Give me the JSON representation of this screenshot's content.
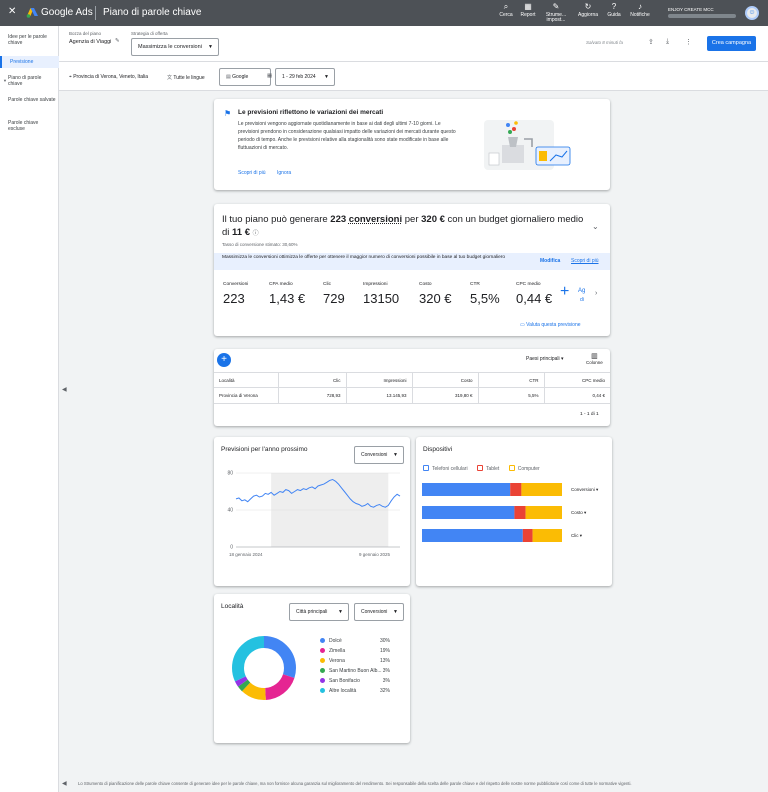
{
  "header": {
    "close_icon": "close-icon",
    "brand": "Google Ads",
    "title": "Piano di parole chiave",
    "toolbar": [
      {
        "label": "Cerca",
        "icon": "search-icon",
        "glyph": "⌕"
      },
      {
        "label": "Report",
        "icon": "report-icon",
        "glyph": "▦"
      },
      {
        "label": "Strume... impost...",
        "icon": "tools-icon",
        "glyph": "✎"
      },
      {
        "label": "Aggiorna",
        "icon": "refresh-icon",
        "glyph": "↻"
      },
      {
        "label": "Guida",
        "icon": "help-icon",
        "glyph": "?"
      },
      {
        "label": "Notifiche",
        "icon": "bell-icon",
        "glyph": "♪"
      }
    ],
    "account": "ENJOY CREATE MCC"
  },
  "sidebar": {
    "items": [
      {
        "label": "Idee per le parole chiave",
        "active": false
      },
      {
        "label": "Previsione",
        "active": true
      },
      {
        "label": "Piano di parole chiave",
        "active": false
      },
      {
        "label": "Parole chiave salvate",
        "active": false
      },
      {
        "label": "Parole chiave escluse",
        "active": false
      }
    ]
  },
  "plan": {
    "draft_label": "Bozza del piano",
    "draft_name": "Agenzia di Viaggi",
    "strategy_label": "Strategia di offerta",
    "strategy_value": "Massimizza le conversioni",
    "saved": "Salvato 8 minuti fa",
    "create_button": "Crea campagna"
  },
  "filters": {
    "location": "Provincia di Verona, Veneto, Italia",
    "languages": "Tutte le lingue",
    "network": "Google",
    "dates": "1 - 29 feb 2024"
  },
  "info": {
    "title": "Le previsioni riflettono le variazioni dei mercati",
    "body": "Le previsioni vengono aggiornate quotidianamente in base ai dati degli ultimi 7-10 giorni. Le previsioni prendono in considerazione qualsiasi impatto delle variazioni dei mercati durante questo periodo di tempo. Anche le previsioni relative alla stagionalità sono state modificate in base alle fluttuazioni di mercato.",
    "learn_more": "Scopri di più",
    "ignore": "Ignora"
  },
  "forecast": {
    "headline_1": "Il tuo piano può generare",
    "conv_count": "223",
    "conv_word": "conversioni",
    "headline_2": "per",
    "cost": "320 €",
    "headline_3": "con un budget giornaliero medio di",
    "budget": "11 €",
    "rate": "Tasso di conversione stimato: 30,60%",
    "banner": "Massimizza le conversioni ottimizza le offerte per ottenere il maggior numero di conversioni possibile in base al tuo budget giornaliero",
    "banner_edit": "Modifica",
    "banner_learn": "Scopri di più",
    "metrics": [
      {
        "label": "Conversioni",
        "value": "223"
      },
      {
        "label": "CPA medio",
        "value": "1,43 €"
      },
      {
        "label": "Clic",
        "value": "729"
      },
      {
        "label": "Impressioni",
        "value": "13150"
      },
      {
        "label": "Costo",
        "value": "320 €"
      },
      {
        "label": "CTR",
        "value": "5,5%"
      },
      {
        "label": "CPC medio",
        "value": "0,44 €"
      }
    ],
    "add_label": "Ag",
    "add_sub": "di",
    "rate_link": "Valuta questa previsione"
  },
  "table": {
    "top_countries": "Paesi principali",
    "columns_label": "Colonne",
    "headers": [
      "Località",
      "Clic",
      "Impressioni",
      "Costo",
      "CTR",
      "CPC medio"
    ],
    "rows": [
      [
        "Provincia di Verona",
        "728,93",
        "13.145,93",
        "319,80 €",
        "5,5%",
        "0,44 €"
      ]
    ],
    "pagination": "1 - 1 di 1"
  },
  "next_year": {
    "title": "Previsioni per l'anno prossimo",
    "selector": "Conversioni",
    "x_start": "18 gennaio 2024",
    "x_end": "9 gennaio 2025"
  },
  "devices": {
    "title": "Dispositivi",
    "legend": [
      {
        "label": "Telefoni cellulari",
        "color": "#4285f4",
        "icon": "phone-icon"
      },
      {
        "label": "Tablet",
        "color": "#ea4335",
        "icon": "tablet-icon"
      },
      {
        "label": "Computer",
        "color": "#fbbc04",
        "icon": "computer-icon"
      }
    ],
    "rows": [
      {
        "selector": "Conversioni",
        "shares": [
          0.63,
          0.08,
          0.29
        ]
      },
      {
        "selector": "Costo",
        "shares": [
          0.66,
          0.08,
          0.26
        ]
      },
      {
        "selector": "Clic",
        "shares": [
          0.72,
          0.07,
          0.21
        ]
      }
    ]
  },
  "locations": {
    "title": "Località",
    "selector_1": "Città principali",
    "selector_2": "Conversioni",
    "items": [
      {
        "name": "Dolcè",
        "pct": "30%",
        "color": "#4285f4"
      },
      {
        "name": "Zimella",
        "pct": "19%",
        "color": "#e52592"
      },
      {
        "name": "Verona",
        "pct": "13%",
        "color": "#fbbc04"
      },
      {
        "name": "San Martino Buon Alb...",
        "pct": "3%",
        "color": "#34a853"
      },
      {
        "name": "San Bonifacio",
        "pct": "3%",
        "color": "#9334e6"
      },
      {
        "name": "Altre località",
        "pct": "32%",
        "color": "#24c1e0"
      }
    ]
  },
  "chart_data": [
    {
      "type": "line",
      "title": "Previsioni per l'anno prossimo",
      "ylim": [
        0,
        80
      ],
      "yticks": [
        0,
        40,
        80
      ],
      "x_labels": [
        "18 gennaio 2024",
        "9 gennaio 2025"
      ],
      "series": [
        {
          "name": "Conversioni",
          "values": [
            52,
            53,
            50,
            51,
            49,
            52,
            55,
            56,
            54,
            55,
            58,
            57,
            59,
            56,
            58,
            60,
            59,
            62,
            61,
            58,
            60,
            62,
            61,
            63,
            62,
            64,
            65,
            63,
            66,
            67,
            68,
            70,
            72,
            73,
            71,
            68,
            64,
            60,
            56,
            52,
            49,
            47,
            46,
            44,
            45,
            47,
            44,
            43,
            45,
            46,
            44,
            43,
            45,
            50,
            54,
            57,
            55
          ]
        }
      ],
      "highlight_range": [
        12,
        52
      ]
    },
    {
      "type": "bar",
      "title": "Dispositivi",
      "categories": [
        "Conversioni",
        "Costo",
        "Clic"
      ],
      "series": [
        {
          "name": "Telefoni cellulari",
          "values": [
            0.63,
            0.66,
            0.72
          ]
        },
        {
          "name": "Tablet",
          "values": [
            0.08,
            0.08,
            0.07
          ]
        },
        {
          "name": "Computer",
          "values": [
            0.29,
            0.26,
            0.21
          ]
        }
      ]
    },
    {
      "type": "pie",
      "title": "Località",
      "categories": [
        "Dolcè",
        "Zimella",
        "Verona",
        "San Martino Buon Alb...",
        "San Bonifacio",
        "Altre località"
      ],
      "values": [
        30,
        19,
        13,
        3,
        3,
        32
      ]
    }
  ],
  "footer": "Lo Strumento di pianificazione delle parole chiave consente di generare idee per le parole chiave, ma non fornisce alcuna garanzia sul miglioramento del rendimento. Sei responsabile della scelta delle parole chiave e del rispetto delle nostre norme pubblicitarie così come di tutte le normative vigenti."
}
